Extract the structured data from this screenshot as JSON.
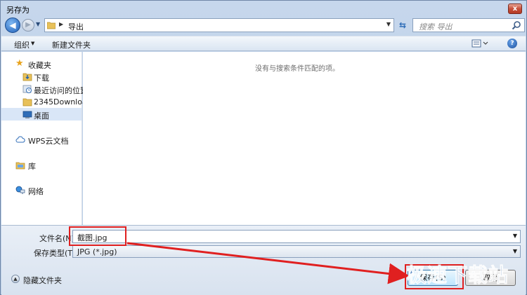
{
  "window": {
    "title": "另存为",
    "close_glyph": "x"
  },
  "nav": {
    "path": "导出",
    "search_placeholder": "搜索 导出"
  },
  "toolbar": {
    "organize_label": "组织",
    "new_folder_label": "新建文件夹",
    "help_glyph": "?"
  },
  "sidebar": {
    "favorites": "收藏夹",
    "items": [
      "下载",
      "最近访问的位置",
      "2345Download",
      "桌面"
    ],
    "wps_cloud": "WPS云文档",
    "library": "库",
    "network": "网络"
  },
  "content": {
    "empty_message": "没有与搜索条件匹配的项。"
  },
  "bottom": {
    "filename_label": "文件名(N):",
    "filename_value": "截图.jpg",
    "filetype_label": "保存类型(T):",
    "filetype_value": "JPG (*.jpg)",
    "hide_folders_label": "隐藏文件夹",
    "save_label": "保存(S)",
    "cancel_label": "取消"
  },
  "watermark": "极速下载站",
  "colors": {
    "annotation_red": "#e02020",
    "accent_blue": "#1f5fae"
  }
}
